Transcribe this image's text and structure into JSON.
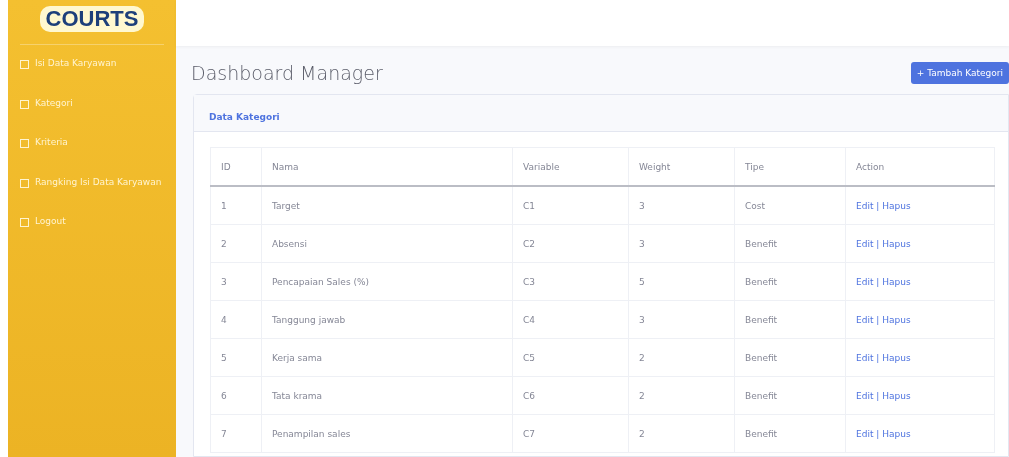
{
  "sidebar": {
    "logo": "COURTS",
    "items": [
      {
        "label": "Isi Data Karyawan",
        "selected": false
      },
      {
        "label": "Kategori",
        "selected": false
      },
      {
        "label": "Kriteria",
        "selected": false
      },
      {
        "label": "Rangking Isi Data Karyawan",
        "selected": false
      },
      {
        "label": "Logout",
        "selected": false
      }
    ]
  },
  "page": {
    "title": "Dashboard Manager",
    "add_button": "+ Tambah Kategori"
  },
  "card": {
    "title": "Data Kategori",
    "table": {
      "columns": [
        "ID",
        "Nama",
        "Variable",
        "Weight",
        "Tipe",
        "Action"
      ],
      "rows": [
        {
          "id": "1",
          "nama": "Target",
          "variable": "C1",
          "weight": "3",
          "tipe": "Cost",
          "edit": "Edit",
          "separator": "|",
          "delete": "Hapus"
        },
        {
          "id": "2",
          "nama": "Absensi",
          "variable": "C2",
          "weight": "3",
          "tipe": "Benefit",
          "edit": "Edit",
          "separator": "|",
          "delete": "Hapus"
        },
        {
          "id": "3",
          "nama": "Pencapaian Sales (%)",
          "variable": "C3",
          "weight": "5",
          "tipe": "Benefit",
          "edit": "Edit",
          "separator": "|",
          "delete": "Hapus"
        },
        {
          "id": "4",
          "nama": "Tanggung jawab",
          "variable": "C4",
          "weight": "3",
          "tipe": "Benefit",
          "edit": "Edit",
          "separator": "|",
          "delete": "Hapus"
        },
        {
          "id": "5",
          "nama": "Kerja sama",
          "variable": "C5",
          "weight": "2",
          "tipe": "Benefit",
          "edit": "Edit",
          "separator": "|",
          "delete": "Hapus"
        },
        {
          "id": "6",
          "nama": "Tata krama",
          "variable": "C6",
          "weight": "2",
          "tipe": "Benefit",
          "edit": "Edit",
          "separator": "|",
          "delete": "Hapus"
        },
        {
          "id": "7",
          "nama": "Penampilan sales",
          "variable": "C7",
          "weight": "2",
          "tipe": "Benefit",
          "edit": "Edit",
          "separator": "|",
          "delete": "Hapus"
        }
      ]
    }
  }
}
